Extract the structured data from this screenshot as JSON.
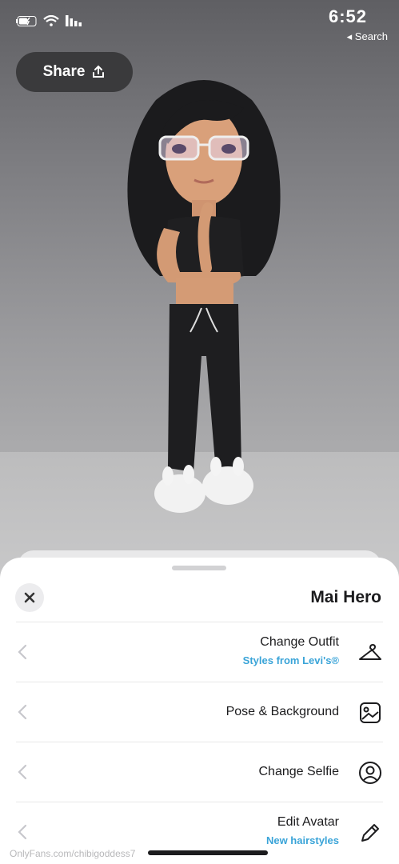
{
  "status_bar": {
    "time": "6:52",
    "back_app": "◂ Search"
  },
  "share_button": {
    "label": "Share"
  },
  "sheet": {
    "title": "Mai Hero",
    "rows": [
      {
        "label": "Change Outfit",
        "sublabel": "Styles from Levi's®",
        "icon": "hanger-icon"
      },
      {
        "label": "Pose & Background",
        "sublabel": "",
        "icon": "image-frame-icon"
      },
      {
        "label": "Change Selfie",
        "sublabel": "",
        "icon": "person-circle-icon"
      },
      {
        "label": "Edit Avatar",
        "sublabel": "New hairstyles",
        "icon": "pencil-icon"
      }
    ]
  },
  "watermark": "OnlyFans.com/chibigoddess7",
  "colors": {
    "accent": "#3aa4d8",
    "share_bg": "#3a3a3c",
    "sheet_bg": "#ffffff"
  }
}
